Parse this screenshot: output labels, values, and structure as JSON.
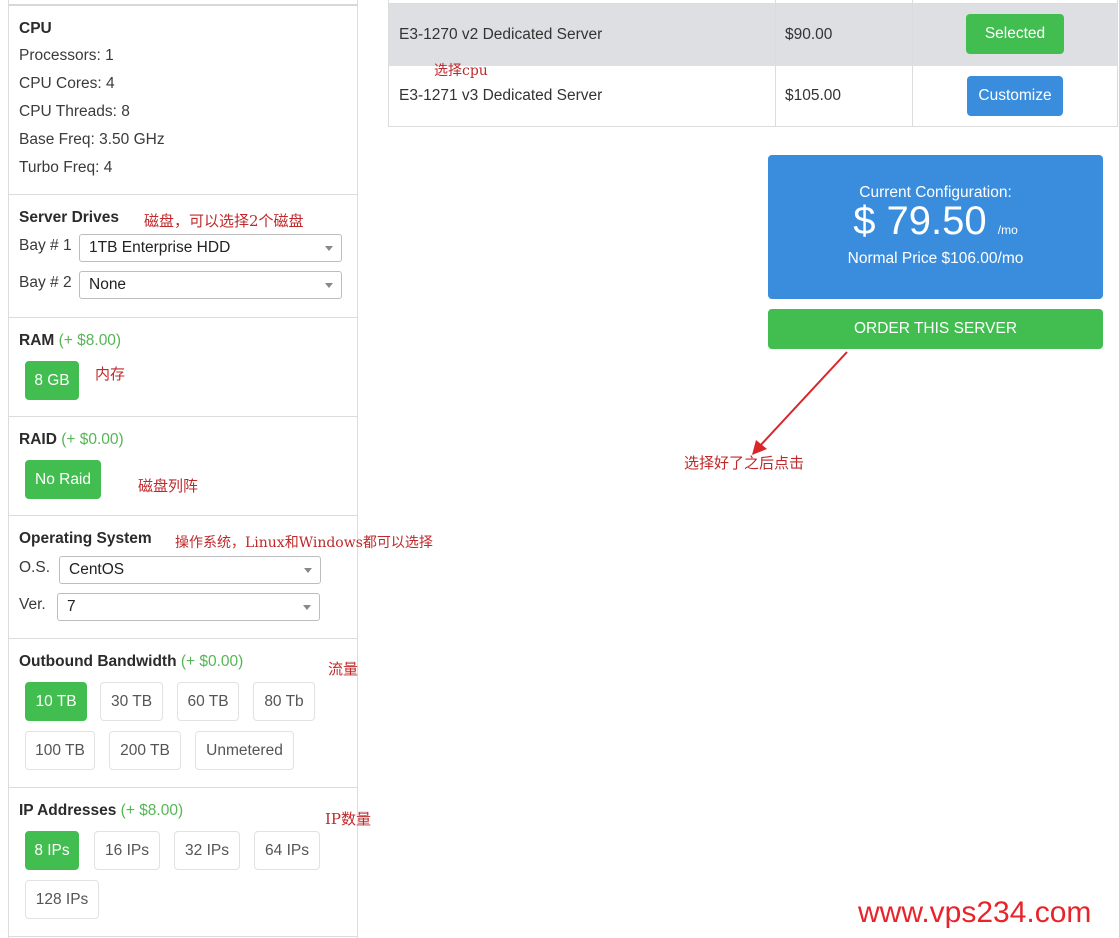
{
  "cpu": {
    "title": "CPU",
    "lines": [
      "Processors: 1",
      "CPU Cores: 4",
      "CPU Threads: 8",
      "Base Freq: 3.50 GHz",
      "Turbo Freq: 4"
    ]
  },
  "drives": {
    "title": "Server Drives",
    "note": "磁盘，可以选择2个磁盘",
    "bays": [
      {
        "label": "Bay # 1",
        "value": "1TB Enterprise HDD"
      },
      {
        "label": "Bay # 2",
        "value": "None"
      }
    ]
  },
  "ram": {
    "title": "RAM",
    "extra": "(+ $8.00)",
    "note": "内存",
    "options": [
      {
        "label": "8 GB",
        "selected": true
      }
    ]
  },
  "raid": {
    "title": "RAID",
    "extra": "(+ $0.00)",
    "note": "磁盘列阵",
    "options": [
      {
        "label": "No Raid",
        "selected": true
      }
    ]
  },
  "os": {
    "title": "Operating System",
    "note": "操作系统，Linux和Windows都可以选择",
    "os_label": "O.S.",
    "os_value": "CentOS",
    "ver_label": "Ver.",
    "ver_value": "7"
  },
  "bandwidth": {
    "title": "Outbound Bandwidth",
    "extra": "(+ $0.00)",
    "note": "流量",
    "options": [
      {
        "label": "10 TB",
        "selected": true
      },
      {
        "label": "30 TB",
        "selected": false
      },
      {
        "label": "60 TB",
        "selected": false
      },
      {
        "label": "80 Tb",
        "selected": false
      },
      {
        "label": "100 TB",
        "selected": false
      },
      {
        "label": "200 TB",
        "selected": false
      },
      {
        "label": "Unmetered",
        "selected": false
      }
    ]
  },
  "ips": {
    "title": "IP Addresses",
    "extra": "(+ $8.00)",
    "note": "IP数量",
    "options": [
      {
        "label": "8 IPs",
        "selected": true
      },
      {
        "label": "16 IPs",
        "selected": false
      },
      {
        "label": "32 IPs",
        "selected": false
      },
      {
        "label": "64 IPs",
        "selected": false
      },
      {
        "label": "128 IPs",
        "selected": false
      }
    ]
  },
  "servers": {
    "note": "选择cpu",
    "rows": [
      {
        "name": "E3-1270 v2 Dedicated Server",
        "price": "$90.00",
        "action": "Selected",
        "selected": true
      },
      {
        "name": "E3-1271 v3 Dedicated Server",
        "price": "$105.00",
        "action": "Customize",
        "selected": false
      }
    ]
  },
  "summary": {
    "title": "Current Configuration:",
    "price": "$ 79.50",
    "unit": "/mo",
    "normal": "Normal Price $106.00/mo",
    "order_label": "ORDER THIS SERVER",
    "note": "选择好了之后点击"
  },
  "watermark": "www.vps234.com",
  "colors": {
    "green": "#42bd50",
    "blue": "#3a8ddd",
    "annotation": "#c0282a"
  }
}
